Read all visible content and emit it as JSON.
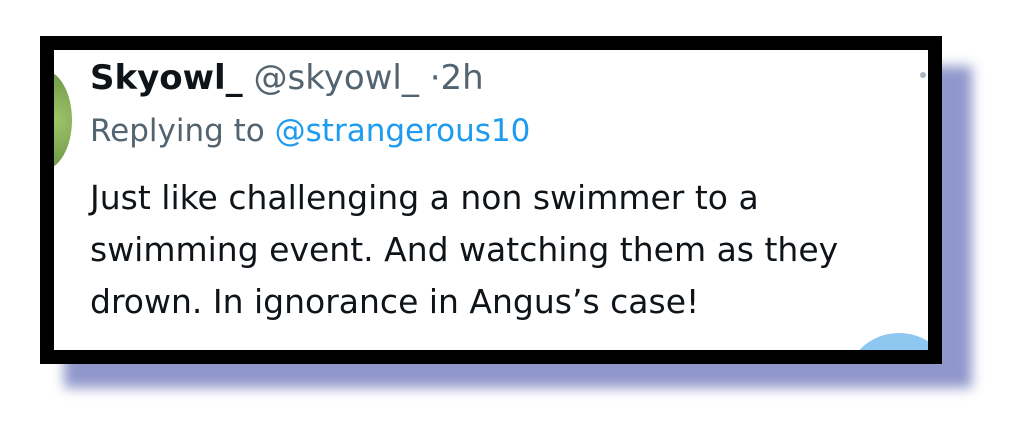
{
  "tweet": {
    "display_name": "Skyowl_",
    "handle": "@skyowl_",
    "separator": "·",
    "timestamp": "2h",
    "replying_prefix": "Replying to",
    "replying_handle": "@strangerous10",
    "text": "Just like challenging a non swimmer to a swimming event. And watching them as they drown. In ignorance in Angus’s case!"
  },
  "colors": {
    "link": "#1d9bf0",
    "secondary_text": "#536471",
    "primary_text": "#0f1419",
    "shadow": "#7d86c2"
  },
  "icons": {
    "avatar": "avatar-image",
    "more": "more-options-icon"
  }
}
